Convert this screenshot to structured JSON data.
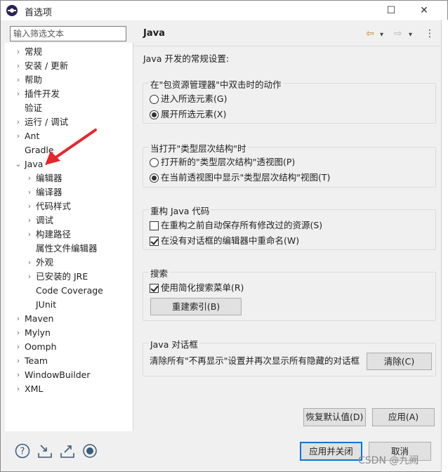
{
  "window": {
    "title": "首选项",
    "controls": {
      "minimize": "—",
      "maximize": "☐",
      "close": "✕"
    }
  },
  "filter": {
    "placeholder": "输入筛选文本",
    "value": ""
  },
  "tree": [
    {
      "label": "常规",
      "twisty": "›"
    },
    {
      "label": "安装 / 更新",
      "twisty": "›"
    },
    {
      "label": "帮助",
      "twisty": "›"
    },
    {
      "label": "插件开发",
      "twisty": "›"
    },
    {
      "label": "验证",
      "twisty": ""
    },
    {
      "label": "运行 / 调试",
      "twisty": "›"
    },
    {
      "label": "Ant",
      "twisty": "›"
    },
    {
      "label": "Gradle",
      "twisty": ""
    },
    {
      "label": "Java",
      "twisty": "⌄"
    },
    {
      "label": "编辑器",
      "twisty": "›"
    },
    {
      "label": "编译器",
      "twisty": "›"
    },
    {
      "label": "代码样式",
      "twisty": "›"
    },
    {
      "label": "调试",
      "twisty": "›"
    },
    {
      "label": "构建路径",
      "twisty": "›"
    },
    {
      "label": "属性文件编辑器",
      "twisty": ""
    },
    {
      "label": "外观",
      "twisty": "›"
    },
    {
      "label": "已安装的 JRE",
      "twisty": "›"
    },
    {
      "label": "Code Coverage",
      "twisty": ""
    },
    {
      "label": "JUnit",
      "twisty": ""
    },
    {
      "label": "Maven",
      "twisty": "›"
    },
    {
      "label": "Mylyn",
      "twisty": "›"
    },
    {
      "label": "Oomph",
      "twisty": "›"
    },
    {
      "label": "Team",
      "twisty": "›"
    },
    {
      "label": "WindowBuilder",
      "twisty": "›"
    },
    {
      "label": "XML",
      "twisty": "›"
    }
  ],
  "page": {
    "title": "Java",
    "nav": {
      "back": "⇦",
      "back_menu": "▾",
      "forward": "⇨",
      "forward_menu": "▾",
      "more": "⋮"
    },
    "general_label": "Java 开发的常规设置:",
    "groups": {
      "double_click": {
        "legend": "在\"包资源管理器\"中双击时的动作",
        "options": [
          {
            "label": "进入所选元素(G)",
            "selected": false
          },
          {
            "label": "展开所选元素(X)",
            "selected": true
          }
        ]
      },
      "open_hierarchy": {
        "legend": "当打开\"类型层次结构\"时",
        "options": [
          {
            "label": "打开新的\"类型层次结构\"透视图(P)",
            "selected": false
          },
          {
            "label": "在当前透视图中显示\"类型层次结构\"视图(T)",
            "selected": true
          }
        ]
      },
      "refactor": {
        "legend": "重构 Java 代码",
        "options": [
          {
            "label": "在重构之前自动保存所有修改过的资源(S)",
            "checked": false
          },
          {
            "label": "在没有对话框的编辑器中重命名(W)",
            "checked": true
          }
        ]
      },
      "search": {
        "legend": "搜索",
        "option": {
          "label": "使用简化搜索菜单(R)",
          "checked": true
        },
        "rebuild_button": "重建索引(B)"
      },
      "dialogs": {
        "legend": "Java 对话框",
        "text": "清除所有\"不再显示\"设置并再次显示所有隐藏的对话框",
        "clear_button": "清除(C)"
      }
    },
    "restore_defaults_button": "恢复默认值(D)",
    "apply_button": "应用(A)"
  },
  "footer": {
    "apply_close_button": "应用并关闭",
    "cancel_button": "取消"
  },
  "watermark": "CSDN @九阙",
  "colors": {
    "arrow": "#e8262a",
    "default_button_border": "#0078d7"
  }
}
